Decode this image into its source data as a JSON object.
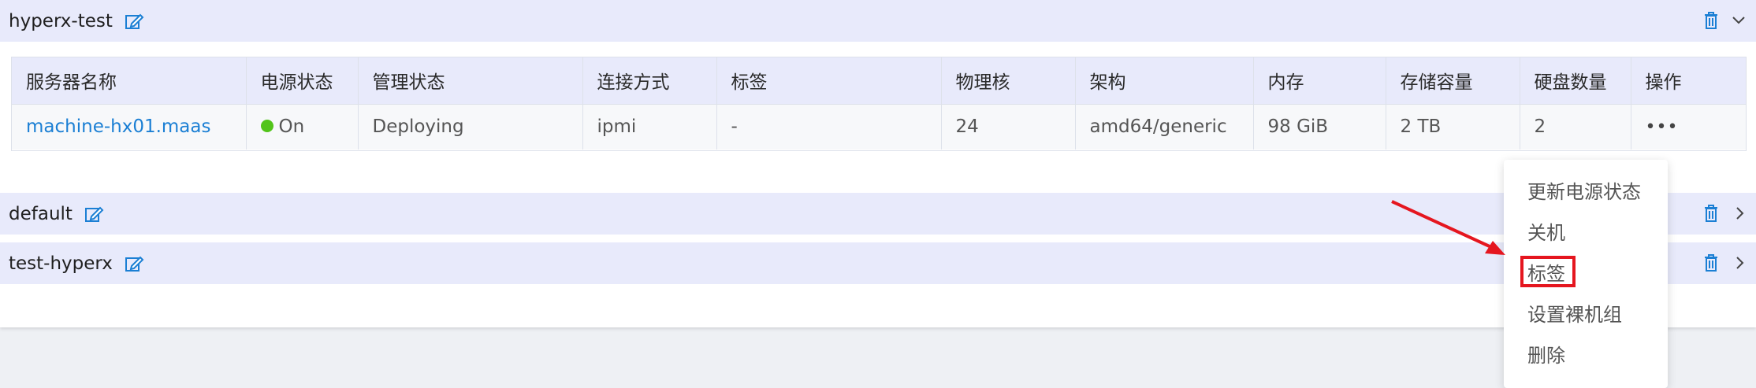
{
  "groups": [
    {
      "name": "hyperx-test",
      "expanded": true
    },
    {
      "name": "default",
      "expanded": false
    },
    {
      "name": "test-hyperx",
      "expanded": false
    }
  ],
  "table": {
    "headers": [
      "服务器名称",
      "电源状态",
      "管理状态",
      "连接方式",
      "标签",
      "物理核",
      "架构",
      "内存",
      "存储容量",
      "硬盘数量",
      "操作"
    ],
    "rows": [
      {
        "name": "machine-hx01.maas",
        "power": "On",
        "status": "Deploying",
        "connection": "ipmi",
        "tags": "-",
        "cores": "24",
        "arch": "amd64/generic",
        "memory": "98 GiB",
        "storage": "2 TB",
        "disks": "2",
        "actions": "•••"
      }
    ]
  },
  "action_menu": {
    "items": [
      "更新电源状态",
      "关机",
      "标签",
      "设置裸机组",
      "删除"
    ],
    "highlighted": "标签"
  },
  "colors": {
    "accent": "#1b7fd4",
    "header_bg": "#e8eafb",
    "power_on": "#52c41a",
    "annotation": "#e5161f"
  }
}
